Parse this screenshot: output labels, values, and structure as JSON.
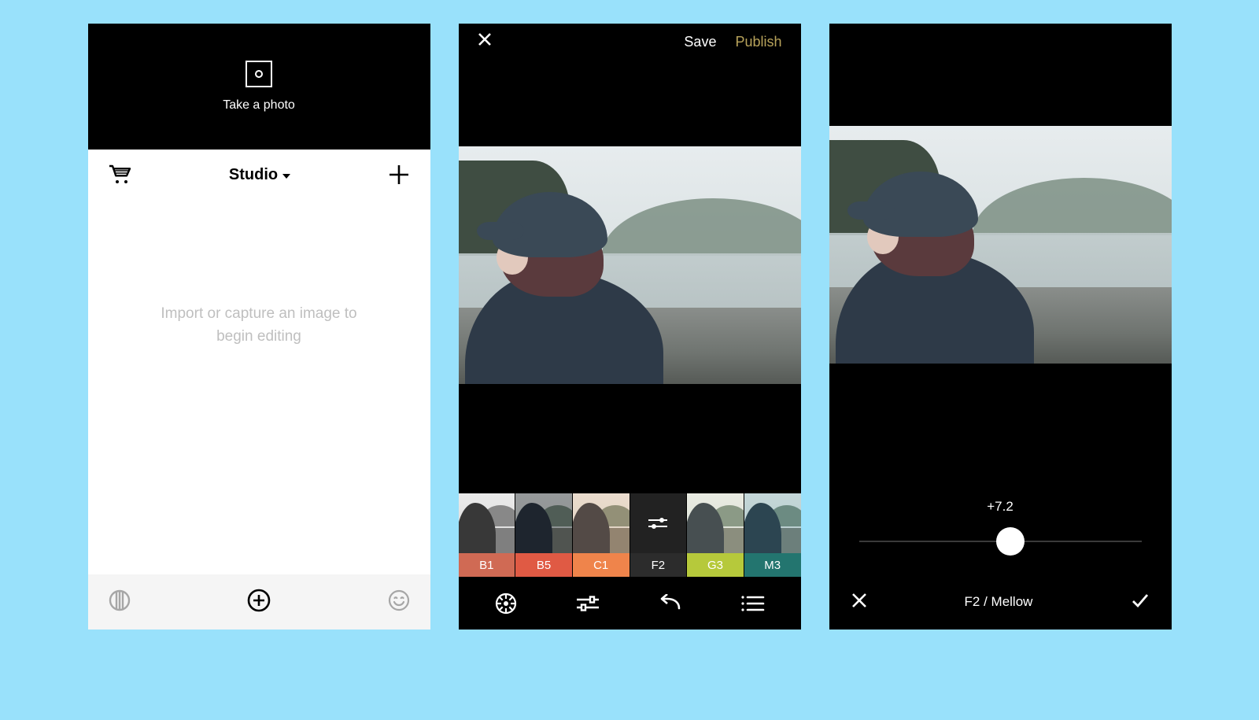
{
  "screen1": {
    "take_photo": "Take a photo",
    "studio_title": "Studio",
    "placeholder": "Import or capture an image to begin editing"
  },
  "screen2": {
    "save": "Save",
    "publish": "Publish",
    "filters": [
      {
        "id": "B1",
        "color": "#d06a54",
        "thumb_class": "bw1"
      },
      {
        "id": "B5",
        "color": "#e05a44",
        "thumb_class": "bw2"
      },
      {
        "id": "C1",
        "color": "#ef844b",
        "thumb_class": "c1"
      },
      {
        "id": "F2",
        "color": "#2c2c2c",
        "thumb_class": "",
        "selected": true
      },
      {
        "id": "G3",
        "color": "#b6c93b",
        "thumb_class": "g3"
      },
      {
        "id": "M3",
        "color": "#23756f",
        "thumb_class": "m3"
      }
    ]
  },
  "screen3": {
    "value_label": "+7.2",
    "value_percent": 53.5,
    "filter_label": "F2 / Mellow"
  }
}
